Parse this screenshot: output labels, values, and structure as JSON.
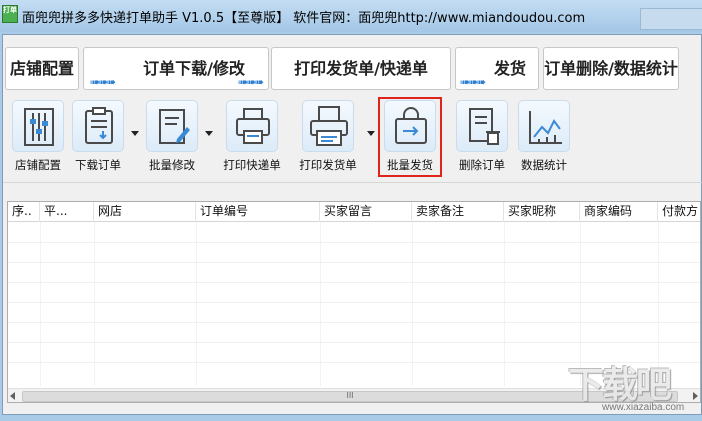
{
  "window": {
    "icon_text": "打单",
    "title": "面兜兜拼多多快递打单助手 V1.0.5【至尊版】 软件官网：面兜兜http://www.miandoudou.com"
  },
  "nav": {
    "steps": [
      "店铺配置",
      "订单下载/修改",
      "打印发货单/快递单",
      "发货",
      "订单删除/数据统计"
    ],
    "arrow": "➠➠➠"
  },
  "toolbar": {
    "items": [
      {
        "label": "店铺配置",
        "icon": "sliders-icon"
      },
      {
        "label": "下载订单",
        "icon": "download-clipboard-icon"
      },
      {
        "label": "批量修改",
        "icon": "edit-document-icon"
      },
      {
        "label": "打印快递单",
        "icon": "printer-icon"
      },
      {
        "label": "打印发货单",
        "icon": "receipt-printer-icon"
      },
      {
        "label": "批量发货",
        "icon": "shipping-bag-icon"
      },
      {
        "label": "删除订单",
        "icon": "delete-document-icon"
      },
      {
        "label": "数据统计",
        "icon": "line-chart-icon"
      }
    ],
    "highlight_color": "#e0241b"
  },
  "grid": {
    "columns": [
      "序..",
      "平...",
      "网店",
      "订单编号",
      "买家留言",
      "卖家备注",
      "买家昵称",
      "商家编码",
      "付款方"
    ],
    "scroll_grip": "III"
  },
  "watermark": {
    "text": "下载吧",
    "url": "www.xiazaiba.com"
  },
  "colors": {
    "accent": "#2f7fd0",
    "titlebar": "#a9cbe8"
  }
}
